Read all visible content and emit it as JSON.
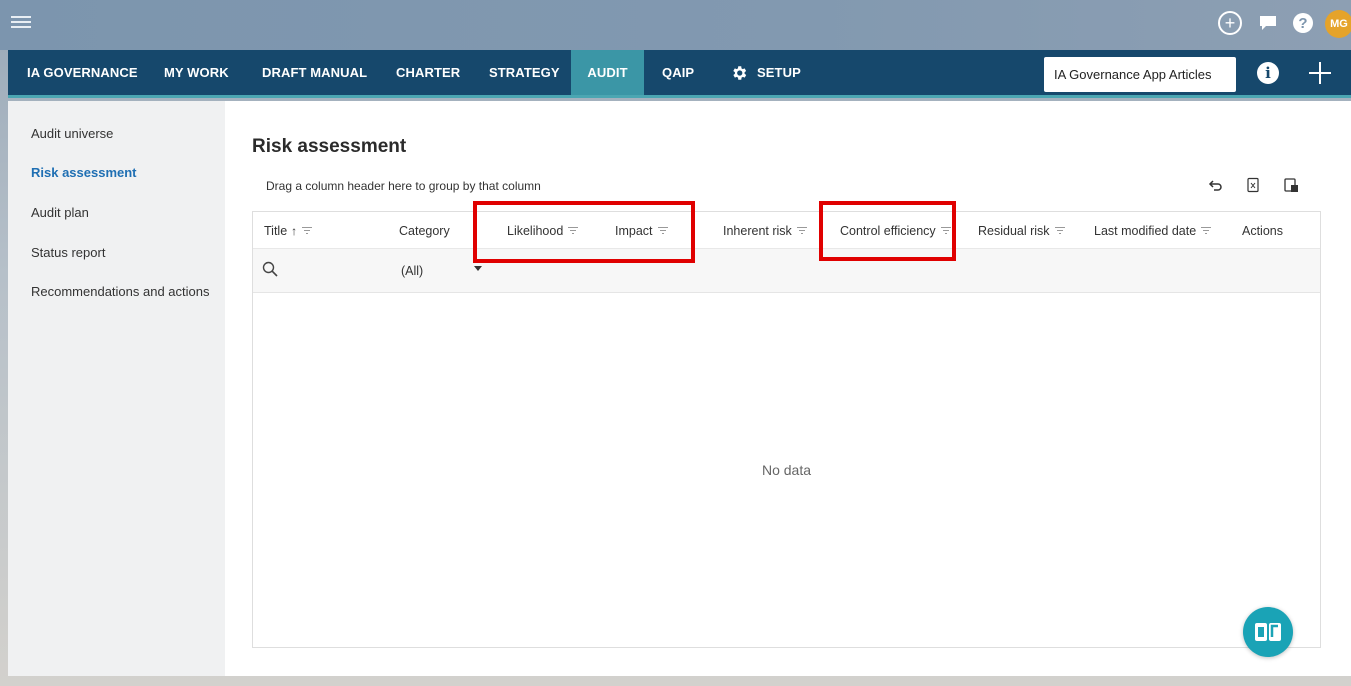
{
  "topbar": {
    "user_initials": "MG"
  },
  "nav": {
    "items": [
      {
        "label": "IA GOVERNANCE"
      },
      {
        "label": "MY WORK"
      },
      {
        "label": "DRAFT MANUAL"
      },
      {
        "label": "CHARTER"
      },
      {
        "label": "STRATEGY"
      },
      {
        "label": "AUDIT"
      },
      {
        "label": "QAIP"
      },
      {
        "label": "SETUP"
      }
    ],
    "active": "AUDIT",
    "search_value": "IA Governance App Articles"
  },
  "sidebar": {
    "items": [
      {
        "label": "Audit universe"
      },
      {
        "label": "Risk assessment"
      },
      {
        "label": "Audit plan"
      },
      {
        "label": "Status report"
      },
      {
        "label": "Recommendations and actions"
      }
    ],
    "active": "Risk assessment"
  },
  "main": {
    "title": "Risk assessment",
    "group_hint": "Drag a column header here to group by that column",
    "columns": [
      {
        "label": "Title"
      },
      {
        "label": "Category"
      },
      {
        "label": "Likelihood"
      },
      {
        "label": "Impact"
      },
      {
        "label": "Inherent risk"
      },
      {
        "label": "Control efficiency"
      },
      {
        "label": "Residual risk"
      },
      {
        "label": "Last modified date"
      },
      {
        "label": "Actions"
      }
    ],
    "category_filter_value": "(All)",
    "empty_message": "No data"
  },
  "colors": {
    "nav_bg": "#16486c",
    "nav_active": "#3b96a6",
    "accent_link": "#1f6fb3",
    "highlight": "#e00000",
    "fab": "#1aa3b6",
    "avatar": "#e5a32a"
  }
}
